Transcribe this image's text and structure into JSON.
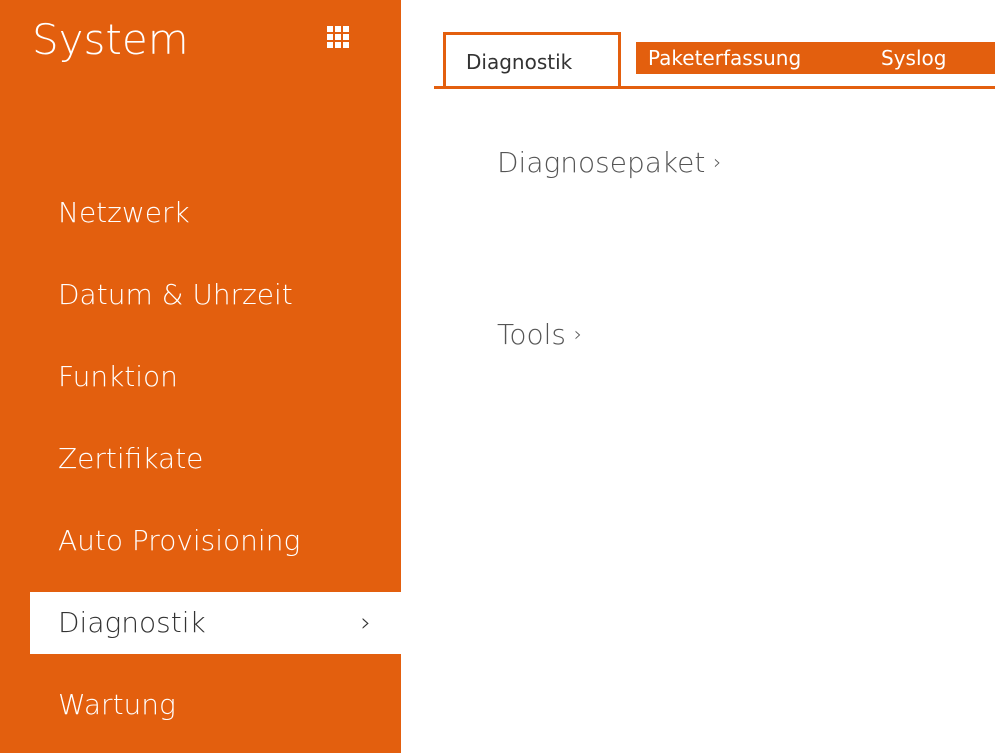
{
  "sidebar": {
    "title": "System",
    "grid_icon": "grid-icon",
    "items": [
      {
        "label": "Netzwerk",
        "active": false
      },
      {
        "label": "Datum & Uhrzeit",
        "active": false
      },
      {
        "label": "Funktion",
        "active": false
      },
      {
        "label": "Zertifikate",
        "active": false
      },
      {
        "label": "Auto Provisioning",
        "active": false
      },
      {
        "label": "Diagnostik",
        "active": true,
        "chevron": "›"
      },
      {
        "label": "Wartung",
        "active": false
      }
    ]
  },
  "tabs": [
    {
      "label": "Diagnostik",
      "active": true
    },
    {
      "label": "Paketerfassung",
      "active": false
    },
    {
      "label": "Syslog",
      "active": false
    }
  ],
  "sections": [
    {
      "label": "Diagnosepaket",
      "chevron": "›"
    },
    {
      "label": "Tools",
      "chevron": "›"
    }
  ],
  "colors": {
    "accent": "#e35f0e",
    "text_dark": "#333333",
    "text_muted": "#555555"
  }
}
